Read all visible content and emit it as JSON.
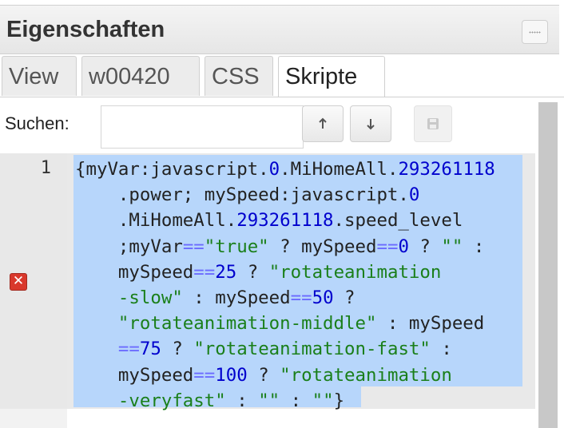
{
  "panel": {
    "title": "Eigenschaften",
    "tabs": [
      {
        "label": "View",
        "active": false
      },
      {
        "label": "w00420",
        "active": false
      },
      {
        "label": "CSS",
        "active": false
      },
      {
        "label": "Skripte",
        "active": true
      }
    ]
  },
  "search": {
    "label": "Suchen:",
    "value": "",
    "placeholder": "",
    "up_icon": "arrow-up-icon",
    "down_icon": "arrow-down-icon",
    "save_icon": "save-icon"
  },
  "editor": {
    "line_numbers": [
      "1"
    ],
    "error_icon": "error-icon",
    "code_lines": [
      [
        {
          "t": "{myVar:javascript.",
          "c": ""
        },
        {
          "t": "0",
          "c": "num"
        },
        {
          "t": ".MiHomeAll.",
          "c": ""
        },
        {
          "t": "293261118",
          "c": "num"
        }
      ],
      [
        {
          "t": "    .power; mySpeed:javascript.",
          "c": ""
        },
        {
          "t": "0",
          "c": "num"
        }
      ],
      [
        {
          "t": "    .MiHomeAll.",
          "c": ""
        },
        {
          "t": "293261118",
          "c": "num"
        },
        {
          "t": ".speed_level",
          "c": ""
        }
      ],
      [
        {
          "t": "    ;myVar",
          "c": ""
        },
        {
          "t": "==",
          "c": "op"
        },
        {
          "t": "\"true\"",
          "c": "str"
        },
        {
          "t": " ? mySpeed",
          "c": ""
        },
        {
          "t": "==",
          "c": "op"
        },
        {
          "t": "0",
          "c": "num"
        },
        {
          "t": " ? ",
          "c": ""
        },
        {
          "t": "\"\"",
          "c": "str"
        },
        {
          "t": " :",
          "c": ""
        }
      ],
      [
        {
          "t": "    mySpeed",
          "c": ""
        },
        {
          "t": "==",
          "c": "op"
        },
        {
          "t": "25",
          "c": "num"
        },
        {
          "t": " ? ",
          "c": ""
        },
        {
          "t": "\"rotateanimation",
          "c": "str"
        }
      ],
      [
        {
          "t": "    -slow\"",
          "c": "str"
        },
        {
          "t": " : mySpeed",
          "c": ""
        },
        {
          "t": "==",
          "c": "op"
        },
        {
          "t": "50",
          "c": "num"
        },
        {
          "t": " ?",
          "c": ""
        }
      ],
      [
        {
          "t": "    \"rotateanimation-middle\"",
          "c": "str"
        },
        {
          "t": " : mySpeed",
          "c": ""
        }
      ],
      [
        {
          "t": "    ",
          "c": ""
        },
        {
          "t": "==",
          "c": "op"
        },
        {
          "t": "75",
          "c": "num"
        },
        {
          "t": " ? ",
          "c": ""
        },
        {
          "t": "\"rotateanimation-fast\"",
          "c": "str"
        },
        {
          "t": " :",
          "c": ""
        }
      ],
      [
        {
          "t": "    mySpeed",
          "c": ""
        },
        {
          "t": "==",
          "c": "op"
        },
        {
          "t": "100",
          "c": "num"
        },
        {
          "t": " ? ",
          "c": ""
        },
        {
          "t": "\"rotateanimation",
          "c": "str"
        }
      ],
      [
        {
          "t": "    -veryfast\"",
          "c": "str"
        },
        {
          "t": " : ",
          "c": ""
        },
        {
          "t": "\"\"",
          "c": "str"
        },
        {
          "t": " : ",
          "c": ""
        },
        {
          "t": "\"\"",
          "c": "str"
        },
        {
          "t": "}",
          "c": ""
        }
      ]
    ]
  }
}
